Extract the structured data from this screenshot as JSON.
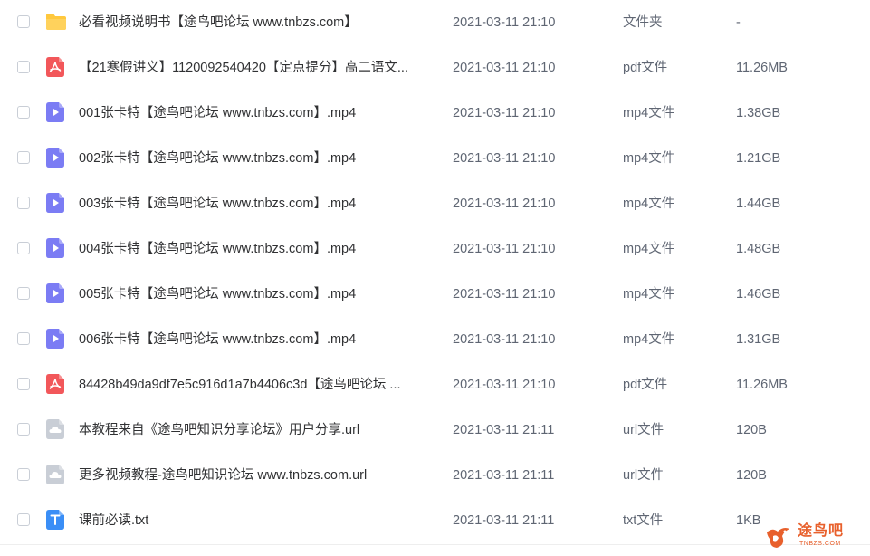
{
  "files": [
    {
      "icon": "folder",
      "name": "必看视频说明书【途鸟吧论坛 www.tnbzs.com】",
      "date": "2021-03-11 21:10",
      "type": "文件夹",
      "size": "-"
    },
    {
      "icon": "pdf",
      "name": "【21寒假讲义】1120092540420【定点提分】高二语文...",
      "date": "2021-03-11 21:10",
      "type": "pdf文件",
      "size": "11.26MB"
    },
    {
      "icon": "video",
      "name": "001张卡特【途鸟吧论坛 www.tnbzs.com】.mp4",
      "date": "2021-03-11 21:10",
      "type": "mp4文件",
      "size": "1.38GB"
    },
    {
      "icon": "video",
      "name": "002张卡特【途鸟吧论坛 www.tnbzs.com】.mp4",
      "date": "2021-03-11 21:10",
      "type": "mp4文件",
      "size": "1.21GB"
    },
    {
      "icon": "video",
      "name": "003张卡特【途鸟吧论坛 www.tnbzs.com】.mp4",
      "date": "2021-03-11 21:10",
      "type": "mp4文件",
      "size": "1.44GB"
    },
    {
      "icon": "video",
      "name": "004张卡特【途鸟吧论坛 www.tnbzs.com】.mp4",
      "date": "2021-03-11 21:10",
      "type": "mp4文件",
      "size": "1.48GB"
    },
    {
      "icon": "video",
      "name": "005张卡特【途鸟吧论坛 www.tnbzs.com】.mp4",
      "date": "2021-03-11 21:10",
      "type": "mp4文件",
      "size": "1.46GB"
    },
    {
      "icon": "video",
      "name": "006张卡特【途鸟吧论坛 www.tnbzs.com】.mp4",
      "date": "2021-03-11 21:10",
      "type": "mp4文件",
      "size": "1.31GB"
    },
    {
      "icon": "pdf",
      "name": "84428b49da9df7e5c916d1a7b4406c3d【途鸟吧论坛 ...",
      "date": "2021-03-11 21:10",
      "type": "pdf文件",
      "size": "11.26MB"
    },
    {
      "icon": "url",
      "name": "本教程来自《途鸟吧知识分享论坛》用户分享.url",
      "date": "2021-03-11 21:11",
      "type": "url文件",
      "size": "120B"
    },
    {
      "icon": "url",
      "name": "更多视频教程-途鸟吧知识论坛 www.tnbzs.com.url",
      "date": "2021-03-11 21:11",
      "type": "url文件",
      "size": "120B"
    },
    {
      "icon": "txt",
      "name": "课前必读.txt",
      "date": "2021-03-11 21:11",
      "type": "txt文件",
      "size": "1KB"
    }
  ],
  "watermark": {
    "text": "途鸟吧",
    "sub": "TNBZS.COM"
  },
  "colors": {
    "folder": "#ffc83d",
    "pdf": "#f2575a",
    "video": "#7b7cf4",
    "url": "#c9ced6",
    "txt": "#3a8ef6",
    "watermark": "#e8602c"
  }
}
